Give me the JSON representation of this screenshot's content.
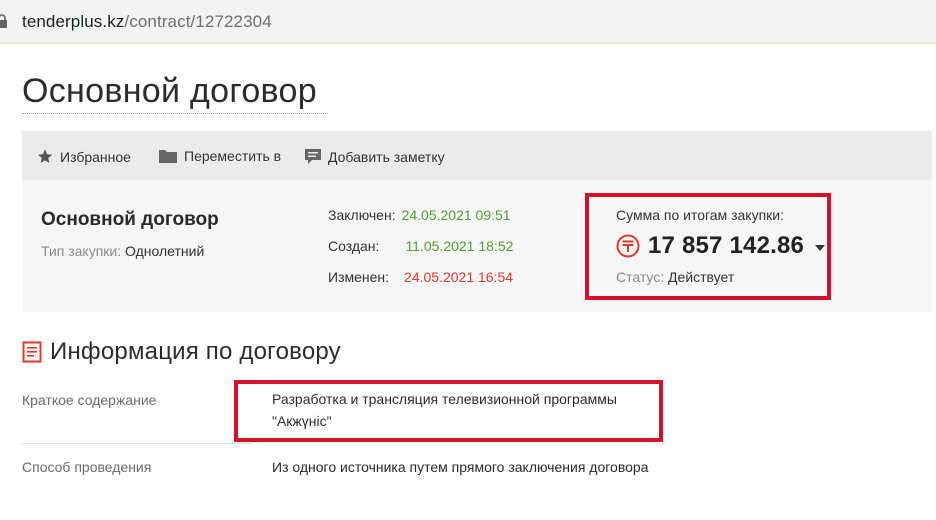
{
  "browser": {
    "url_host": "tenderplus.kz",
    "url_path": "/contract/12722304"
  },
  "page": {
    "title": "Основной договор"
  },
  "toolbar": {
    "favorite_label": "Избранное",
    "move_label": "Переместить в",
    "note_label": "Добавить заметку"
  },
  "summary": {
    "contract_name": "Основной договор",
    "procurement_type_label": "Тип закупки:",
    "procurement_type_value": "Однолетний",
    "concluded_label": "Заключен:",
    "concluded_value": "24.05.2021 09:51",
    "created_label": "Создан:",
    "created_value": "11.05.2021 18:52",
    "modified_label": "Изменен:",
    "modified_value": "24.05.2021 16:54",
    "sum_label": "Сумма по итогам закупки:",
    "sum_value": "17 857 142.86",
    "currency_symbol": "₸",
    "status_label": "Статус:",
    "status_value": "Действует"
  },
  "info": {
    "section_title": "Информация по договору",
    "rows": [
      {
        "label": "Краткое содержание",
        "value": "Разработка и трансляция телевизионной программы \"Акжүніс\""
      },
      {
        "label": "Способ проведения",
        "value": "Из одного источника путем прямого заключения договора"
      }
    ]
  },
  "colors": {
    "highlight": "#d3122a",
    "green_date": "#4a9f2d",
    "red_date": "#d83b2e",
    "toolbar_bg": "#ebebeb",
    "summary_bg": "#f6f6f6"
  }
}
